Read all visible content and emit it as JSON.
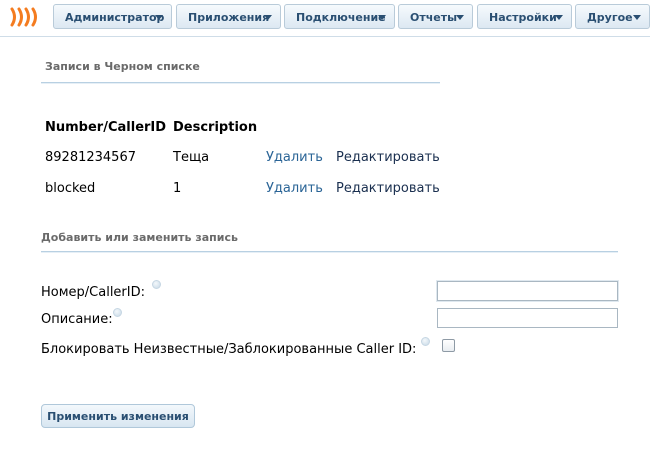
{
  "nav": {
    "items": [
      {
        "label": "Администратор"
      },
      {
        "label": "Приложения"
      },
      {
        "label": "Подключение"
      },
      {
        "label": "Отчеты"
      },
      {
        "label": "Настройки"
      },
      {
        "label": "Другое"
      }
    ]
  },
  "blacklist": {
    "title": "Записи в Черном списке",
    "columns": [
      "Number/CallerID",
      "Description"
    ],
    "rows": [
      {
        "number": "89281234567",
        "description": "Теща",
        "delete": "Удалить",
        "edit": "Редактировать"
      },
      {
        "number": "blocked",
        "description": "1",
        "delete": "Удалить",
        "edit": "Редактировать"
      }
    ]
  },
  "form": {
    "title": "Добавить или заменить запись",
    "number_label": "Номер/CallerID:",
    "number_value": "",
    "description_label": "Описание:",
    "description_value": "",
    "block_label": "Блокировать Неизвестные/Заблокированные Caller ID:",
    "block_checked": false,
    "apply_label": "Применить изменения"
  },
  "colors": {
    "nav_text": "#2a4f72",
    "link": "#2a6496",
    "rule": "#b8d0e2",
    "logo": "#f47c20"
  },
  "icons": {
    "logo": "freepbx-logo",
    "caret": "caret-down-icon",
    "help": "help-bubble-icon"
  }
}
